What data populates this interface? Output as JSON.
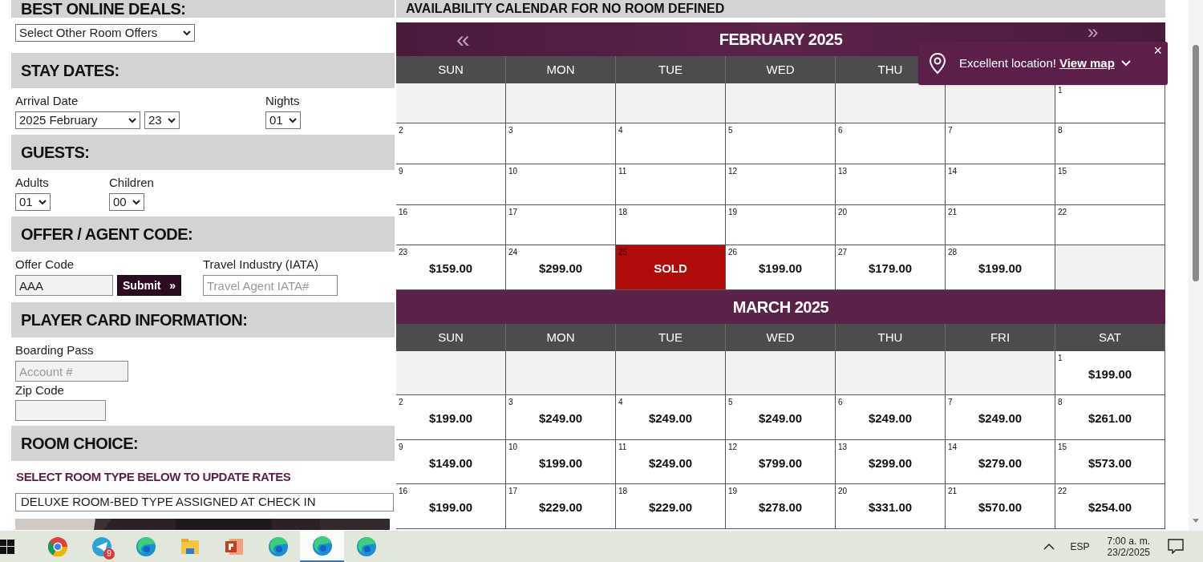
{
  "best_deals": {
    "heading": "BEST ONLINE DEALS:",
    "offers_select": "Select Other Room Offers"
  },
  "stay_dates": {
    "heading": "STAY DATES:",
    "arrival_label": "Arrival Date",
    "month_select": "2025 February",
    "day_select": "23",
    "nights_label": "Nights",
    "nights_select": "01"
  },
  "guests": {
    "heading": "GUESTS:",
    "adults_label": "Adults",
    "adults_select": "01",
    "children_label": "Children",
    "children_select": "00"
  },
  "offer_code": {
    "heading": "OFFER / AGENT CODE:",
    "offer_label": "Offer Code",
    "offer_value": "AAA",
    "submit": "Submit",
    "submit_icon": "»",
    "iata_label": "Travel Industry (IATA)",
    "iata_placeholder": "Travel Agent IATA#"
  },
  "player_card": {
    "heading": "PLAYER CARD INFORMATION:",
    "boarding_label": "Boarding Pass",
    "account_placeholder": "Account #",
    "zip_label": "Zip Code"
  },
  "room_choice": {
    "heading": "ROOM CHOICE:",
    "hint": "SELECT ROOM TYPE BELOW TO UPDATE RATES",
    "room_select": "DELUXE ROOM-BED TYPE ASSIGNED AT CHECK IN"
  },
  "calendar": {
    "heading": "AVAILABILITY CALENDAR FOR NO ROOM DEFINED",
    "prev": "«",
    "next": "»",
    "months": [
      {
        "title": "FEBRUARY 2025",
        "weekdays": [
          "SUN",
          "MON",
          "TUE",
          "WED",
          "THU"
        ],
        "weeks": [
          [
            {
              "kind": "blank"
            },
            {
              "kind": "blank"
            },
            {
              "kind": "blank"
            },
            {
              "kind": "blank"
            },
            {
              "kind": "blank"
            },
            {
              "kind": "blank"
            },
            {
              "kind": "date",
              "day": "1"
            }
          ],
          [
            {
              "kind": "date",
              "day": "2"
            },
            {
              "kind": "date",
              "day": "3"
            },
            {
              "kind": "date",
              "day": "4"
            },
            {
              "kind": "date",
              "day": "5"
            },
            {
              "kind": "date",
              "day": "6"
            },
            {
              "kind": "date",
              "day": "7"
            },
            {
              "kind": "date",
              "day": "8"
            }
          ],
          [
            {
              "kind": "date",
              "day": "9"
            },
            {
              "kind": "date",
              "day": "10"
            },
            {
              "kind": "date",
              "day": "11"
            },
            {
              "kind": "date",
              "day": "12"
            },
            {
              "kind": "date",
              "day": "13"
            },
            {
              "kind": "date",
              "day": "14"
            },
            {
              "kind": "date",
              "day": "15"
            }
          ],
          [
            {
              "kind": "date",
              "day": "16"
            },
            {
              "kind": "date",
              "day": "17"
            },
            {
              "kind": "date",
              "day": "18"
            },
            {
              "kind": "date",
              "day": "19"
            },
            {
              "kind": "date",
              "day": "20"
            },
            {
              "kind": "date",
              "day": "21"
            },
            {
              "kind": "date",
              "day": "22"
            }
          ],
          [
            {
              "kind": "price",
              "day": "23",
              "price": "$159.00"
            },
            {
              "kind": "price",
              "day": "24",
              "price": "$299.00"
            },
            {
              "kind": "sold",
              "day": "25",
              "label": "SOLD"
            },
            {
              "kind": "price",
              "day": "26",
              "price": "$199.00"
            },
            {
              "kind": "price",
              "day": "27",
              "price": "$179.00"
            },
            {
              "kind": "price",
              "day": "28",
              "price": "$199.00"
            },
            {
              "kind": "blank"
            }
          ]
        ]
      },
      {
        "title": "MARCH 2025",
        "weekdays": [
          "SUN",
          "MON",
          "TUE",
          "WED",
          "THU",
          "FRI",
          "SAT"
        ],
        "weeks": [
          [
            {
              "kind": "blank"
            },
            {
              "kind": "blank"
            },
            {
              "kind": "blank"
            },
            {
              "kind": "blank"
            },
            {
              "kind": "blank"
            },
            {
              "kind": "blank"
            },
            {
              "kind": "price",
              "day": "1",
              "price": "$199.00"
            }
          ],
          [
            {
              "kind": "price",
              "day": "2",
              "price": "$199.00"
            },
            {
              "kind": "price",
              "day": "3",
              "price": "$249.00"
            },
            {
              "kind": "price",
              "day": "4",
              "price": "$249.00"
            },
            {
              "kind": "price",
              "day": "5",
              "price": "$249.00"
            },
            {
              "kind": "price",
              "day": "6",
              "price": "$249.00"
            },
            {
              "kind": "price",
              "day": "7",
              "price": "$249.00"
            },
            {
              "kind": "price",
              "day": "8",
              "price": "$261.00"
            }
          ],
          [
            {
              "kind": "price",
              "day": "9",
              "price": "$149.00"
            },
            {
              "kind": "price",
              "day": "10",
              "price": "$199.00"
            },
            {
              "kind": "price",
              "day": "11",
              "price": "$249.00"
            },
            {
              "kind": "price",
              "day": "12",
              "price": "$799.00"
            },
            {
              "kind": "price",
              "day": "13",
              "price": "$299.00"
            },
            {
              "kind": "price",
              "day": "14",
              "price": "$279.00"
            },
            {
              "kind": "price",
              "day": "15",
              "price": "$573.00"
            }
          ],
          [
            {
              "kind": "price",
              "day": "16",
              "price": "$199.00"
            },
            {
              "kind": "price",
              "day": "17",
              "price": "$229.00"
            },
            {
              "kind": "price",
              "day": "18",
              "price": "$229.00"
            },
            {
              "kind": "price",
              "day": "19",
              "price": "$278.00"
            },
            {
              "kind": "price",
              "day": "20",
              "price": "$331.00"
            },
            {
              "kind": "price",
              "day": "21",
              "price": "$570.00"
            },
            {
              "kind": "price",
              "day": "22",
              "price": "$254.00"
            }
          ]
        ]
      }
    ]
  },
  "location_popup": {
    "text": "Excellent location!",
    "link": "View map",
    "close": "×"
  },
  "taskbar": {
    "apps": [
      {
        "kind": "chrome",
        "selected": false
      },
      {
        "kind": "telegram",
        "badge": "9",
        "selected": false
      },
      {
        "kind": "edge",
        "selected": false
      },
      {
        "kind": "files",
        "selected": false
      },
      {
        "kind": "powerpoint",
        "selected": false
      },
      {
        "kind": "edge",
        "selected": false
      },
      {
        "kind": "edge",
        "selected": true
      },
      {
        "kind": "edge",
        "selected": false
      }
    ],
    "language": "ESP",
    "time": "7:00 a. m.",
    "date": "23/2/2025"
  }
}
